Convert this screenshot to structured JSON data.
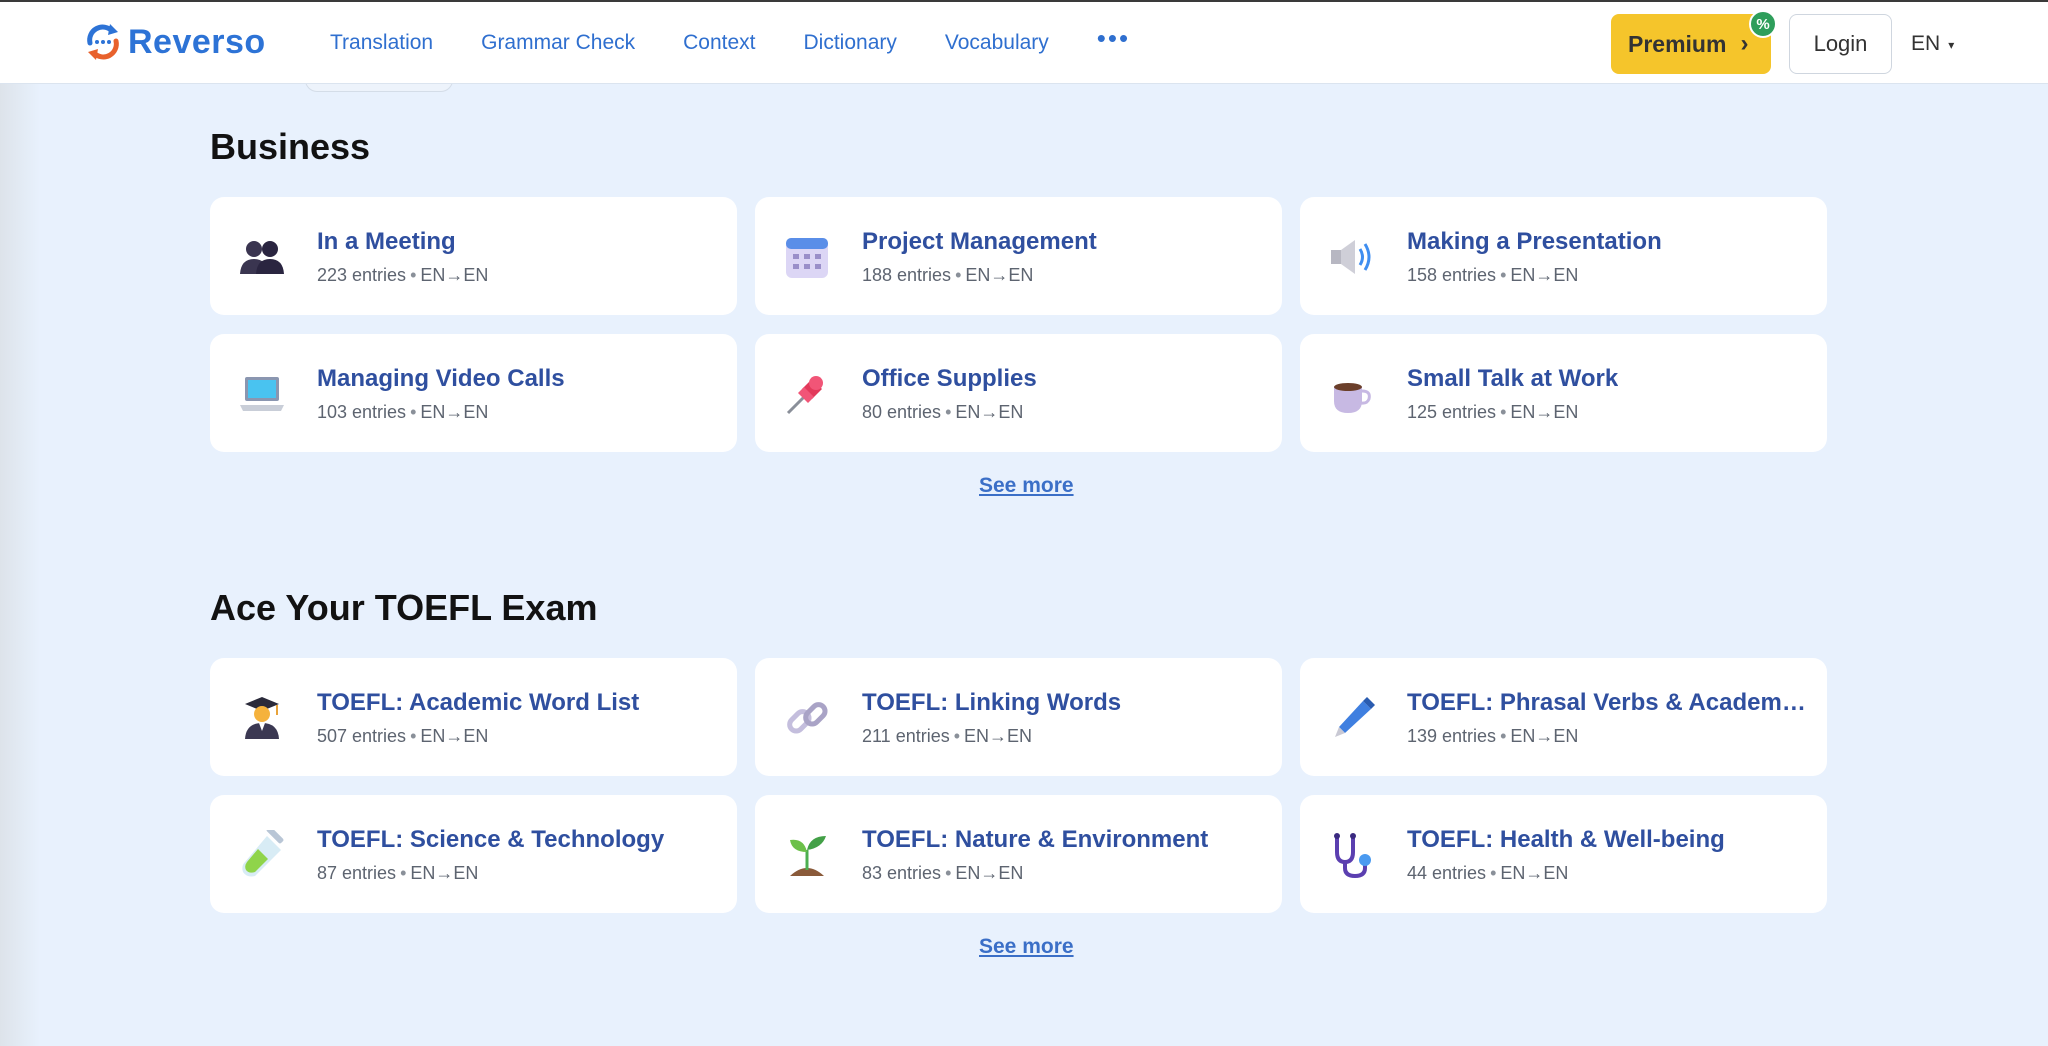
{
  "header": {
    "logo_text": "Reverso",
    "nav": [
      "Translation",
      "Grammar Check",
      "Context",
      "Dictionary",
      "Vocabulary"
    ],
    "more": "•••",
    "premium_label": "Premium",
    "premium_chevron": "›",
    "premium_badge": "%",
    "login_label": "Login",
    "lang_label": "EN",
    "lang_caret": "▾"
  },
  "sections": [
    {
      "title": "Business",
      "see_more": "See more",
      "cards": [
        {
          "title": "In a Meeting",
          "entries": "223 entries",
          "langs": "EN→EN",
          "icon": "people-icon"
        },
        {
          "title": "Project Management",
          "entries": "188 entries",
          "langs": "EN→EN",
          "icon": "calendar-icon"
        },
        {
          "title": "Making a Presentation",
          "entries": "158 entries",
          "langs": "EN→EN",
          "icon": "speaker-icon"
        },
        {
          "title": "Managing Video Calls",
          "entries": "103 entries",
          "langs": "EN→EN",
          "icon": "laptop-icon"
        },
        {
          "title": "Office Supplies",
          "entries": "80 entries",
          "langs": "EN→EN",
          "icon": "pushpin-icon"
        },
        {
          "title": "Small Talk at Work",
          "entries": "125 entries",
          "langs": "EN→EN",
          "icon": "coffee-icon"
        }
      ]
    },
    {
      "title": "Ace Your TOEFL Exam",
      "see_more": "See more",
      "cards": [
        {
          "title": "TOEFL: Academic Word List",
          "entries": "507 entries",
          "langs": "EN→EN",
          "icon": "graduate-icon"
        },
        {
          "title": "TOEFL: Linking Words",
          "entries": "211 entries",
          "langs": "EN→EN",
          "icon": "link-icon"
        },
        {
          "title": "TOEFL: Phrasal Verbs & Academic ...",
          "entries": "139 entries",
          "langs": "EN→EN",
          "icon": "pen-icon"
        },
        {
          "title": "TOEFL: Science & Technology",
          "entries": "87 entries",
          "langs": "EN→EN",
          "icon": "test-tube-icon"
        },
        {
          "title": "TOEFL: Nature & Environment",
          "entries": "83 entries",
          "langs": "EN→EN",
          "icon": "seedling-icon"
        },
        {
          "title": "TOEFL: Health & Well-being",
          "entries": "44 entries",
          "langs": "EN→EN",
          "icon": "stethoscope-icon"
        }
      ]
    }
  ],
  "colors": {
    "brand": "#2d73d6",
    "background": "#e8f1fd",
    "premium": "#f5c52b",
    "card_title": "#2f4f9f"
  }
}
